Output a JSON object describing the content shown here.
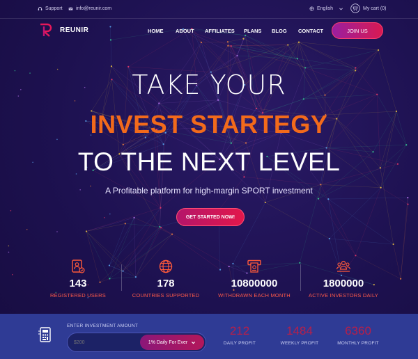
{
  "topbar": {
    "support_label": "Support",
    "email": "info@reunir.com",
    "language": "English",
    "cart_label": "My cart (0)"
  },
  "brand": {
    "name": "REUNIR",
    "accent": "#e6185a"
  },
  "nav": {
    "items": [
      "HOME",
      "ABOUT",
      "AFFILIATES",
      "PLANS",
      "BLOG",
      "CONTACT"
    ],
    "join_label": "JOIN US"
  },
  "hero": {
    "line1": "TAKE YOUR",
    "line2": "INVEST STARTEGY",
    "line3": "TO THE NEXT LEVEL",
    "subtitle": "A Profitable platform for high-margin SPORT investment",
    "cta_label": "GET STARTED NOW!",
    "highlight_color": "#f26a1b"
  },
  "stats": [
    {
      "icon": "registered-users-icon",
      "value": "143",
      "label": "REGISTERED USERS"
    },
    {
      "icon": "globe-icon",
      "value": "178",
      "label": "COUNTRIES SUPPORTED"
    },
    {
      "icon": "withdraw-icon",
      "value": "10800000",
      "label": "WITHDRAWN EACH MONTH"
    },
    {
      "icon": "investors-icon",
      "value": "1800000",
      "label": "ACTIVE INVESTORS DAILY"
    }
  ],
  "calculator": {
    "enter_label": "ENTER INVESTMENT AMOUNT",
    "amount_placeholder": "$200",
    "plan_selected": "1% Daily For Ever",
    "profits": [
      {
        "value": "212",
        "label": "DAILY PROFIT"
      },
      {
        "value": "1484",
        "label": "WEEKLY PROFIT"
      },
      {
        "value": "6360",
        "label": "MONTHLY PROFIT"
      }
    ]
  }
}
